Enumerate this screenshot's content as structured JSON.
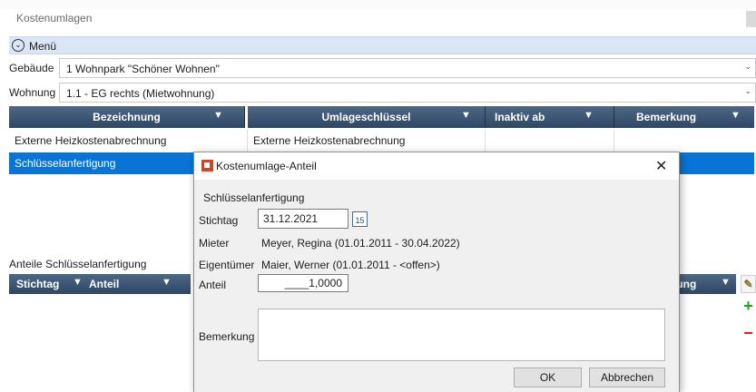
{
  "window": {
    "title": "Kostenumlagen"
  },
  "menu": {
    "label": "Menü"
  },
  "fields": {
    "gebaeude_label": "Gebäude",
    "gebaeude_value": "1 Wohnpark \"Schöner Wohnen\"",
    "wohnung_label": "Wohnung",
    "wohnung_value": "1.1 - EG rechts (Mietwohnung)"
  },
  "grid": {
    "columns": [
      "Bezeichnung",
      "Umlageschlüssel",
      "Inaktiv ab",
      "Bemerkung"
    ],
    "rows": [
      {
        "bezeichnung": "Externe Heizkostenabrechnung",
        "umlageschluessel": "Externe Heizkostenabrechnung",
        "inaktiv_ab": "",
        "bemerkung": ""
      },
      {
        "bezeichnung": "Schlüsselanfertigung",
        "umlageschluessel": "",
        "inaktiv_ab": "",
        "bemerkung": ""
      }
    ]
  },
  "anteile": {
    "title": "Anteile Schlüsselanfertigung",
    "columns": [
      "Stichtag",
      "Anteil"
    ],
    "right_column": "rkung"
  },
  "dialog": {
    "title": "Kostenumlage-Anteil",
    "subtitle": "Schlüsselanfertigung",
    "stichtag_label": "Stichtag",
    "stichtag_value": "31.12.2021",
    "calendar_day": "15",
    "mieter_label": "Mieter",
    "mieter_value": "Meyer, Regina (01.01.2011 - 30.04.2022)",
    "eigentuemer_label": "Eigentümer",
    "eigentuemer_value": "Maier, Werner (01.01.2011 - <offen>)",
    "anteil_label": "Anteil",
    "anteil_value": "____1,0000",
    "bemerkung_label": "Bemerkung",
    "bemerkung_value": "",
    "ok_label": "OK",
    "cancel_label": "Abbrechen"
  },
  "colors": {
    "header": "#3a5473",
    "selection": "#0a74d6",
    "menubar": "#dbe6f4"
  }
}
